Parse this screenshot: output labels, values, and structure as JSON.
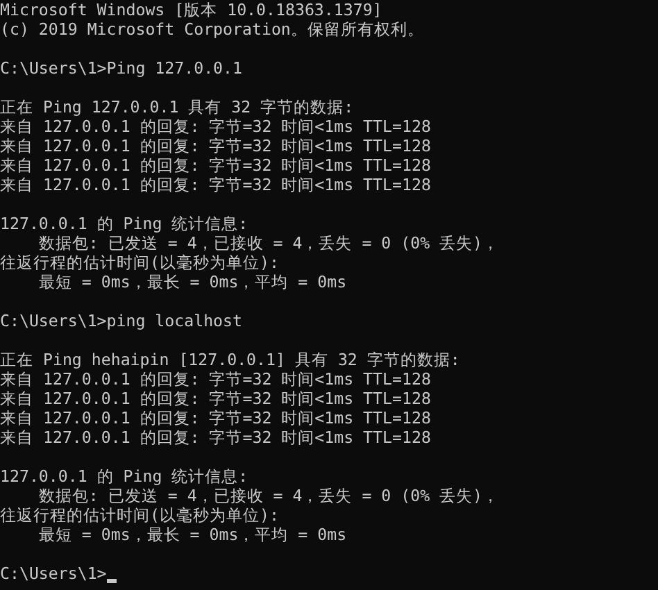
{
  "console": {
    "blocks": [
      [
        "Microsoft Windows [版本 10.0.18363.1379]",
        "(c) 2019 Microsoft Corporation。保留所有权利。"
      ],
      [
        "C:\\Users\\1>Ping 127.0.0.1"
      ],
      [
        "正在 Ping 127.0.0.1 具有 32 字节的数据:",
        "来自 127.0.0.1 的回复: 字节=32 时间<1ms TTL=128",
        "来自 127.0.0.1 的回复: 字节=32 时间<1ms TTL=128",
        "来自 127.0.0.1 的回复: 字节=32 时间<1ms TTL=128",
        "来自 127.0.0.1 的回复: 字节=32 时间<1ms TTL=128"
      ],
      [
        "127.0.0.1 的 Ping 统计信息:",
        "    数据包: 已发送 = 4，已接收 = 4，丢失 = 0 (0% 丢失)，",
        "往返行程的估计时间(以毫秒为单位):",
        "    最短 = 0ms，最长 = 0ms，平均 = 0ms"
      ],
      [
        "C:\\Users\\1>ping localhost"
      ],
      [
        "正在 Ping hehaipin [127.0.0.1] 具有 32 字节的数据:",
        "来自 127.0.0.1 的回复: 字节=32 时间<1ms TTL=128",
        "来自 127.0.0.1 的回复: 字节=32 时间<1ms TTL=128",
        "来自 127.0.0.1 的回复: 字节=32 时间<1ms TTL=128",
        "来自 127.0.0.1 的回复: 字节=32 时间<1ms TTL=128"
      ],
      [
        "127.0.0.1 的 Ping 统计信息:",
        "    数据包: 已发送 = 4，已接收 = 4，丢失 = 0 (0% 丢失)，",
        "往返行程的估计时间(以毫秒为单位):",
        "    最短 = 0ms，最长 = 0ms，平均 = 0ms"
      ]
    ],
    "prompt": "C:\\Users\\1>"
  }
}
